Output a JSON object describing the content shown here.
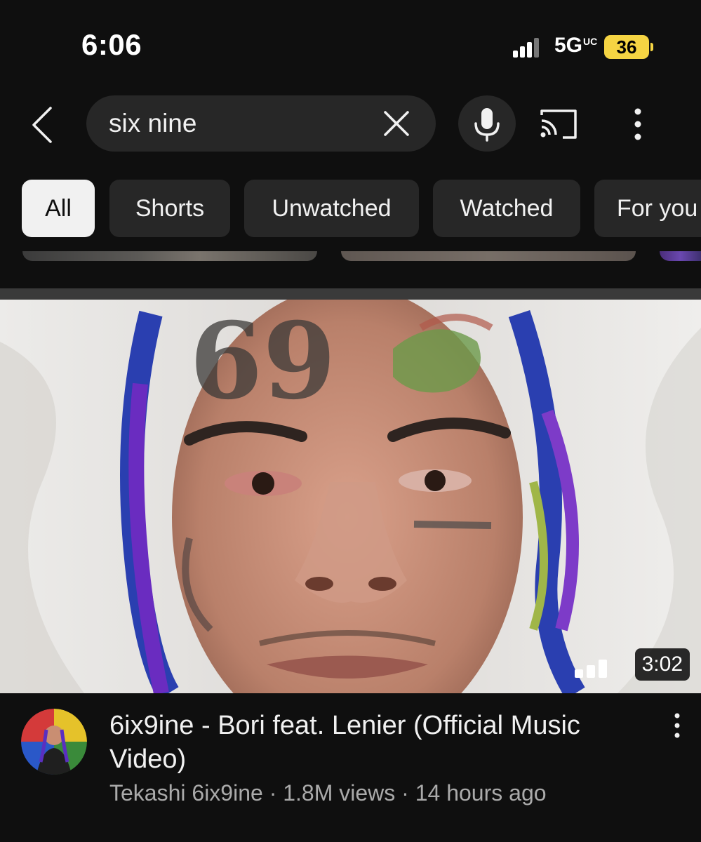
{
  "status_bar": {
    "time": "6:06",
    "network": "5G",
    "network_sub": "UC",
    "battery": "36"
  },
  "search": {
    "query": "six nine"
  },
  "chips": [
    {
      "label": "All",
      "active": true
    },
    {
      "label": "Shorts",
      "active": false
    },
    {
      "label": "Unwatched",
      "active": false
    },
    {
      "label": "Watched",
      "active": false
    },
    {
      "label": "For you",
      "active": false
    }
  ],
  "video": {
    "title": "6ix9ine - Bori feat. Lenier (Official Music Video)",
    "channel": "Tekashi 6ix9ine",
    "views": "1.8M views",
    "age": "14 hours ago",
    "separator": " · ",
    "duration": "3:02"
  },
  "icons": [
    "back-arrow-icon",
    "close-icon",
    "mic-icon",
    "cast-icon",
    "more-vertical-icon",
    "signal-icon",
    "battery-icon",
    "hd-bars-icon"
  ],
  "colors": {
    "background": "#0f0f0f",
    "surface": "#272727",
    "active_chip": "#f1f1f1",
    "battery": "#f5d443",
    "meta_text": "#aaaaaa"
  }
}
